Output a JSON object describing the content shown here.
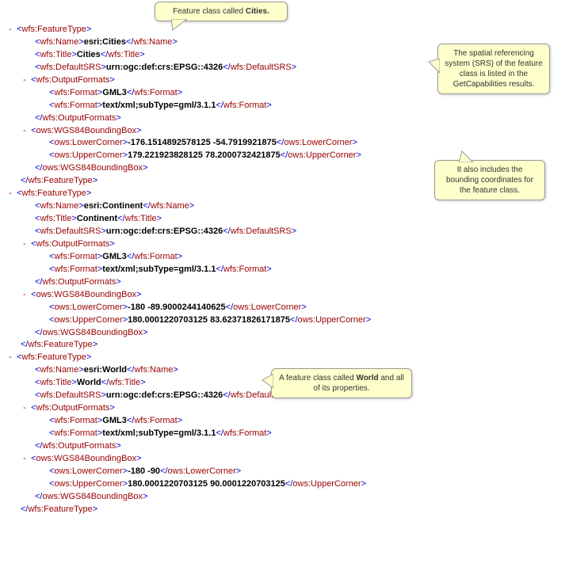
{
  "callout1": {
    "pre": "Feature class called ",
    "bold": "Cities.",
    "post": ""
  },
  "callout2": "The spatial referencing system (SRS) of the feature class is listed in the GetCapabilities results.",
  "callout3": "It also includes the bounding coordinates for the feature class.",
  "callout4": {
    "pre": "A feature class called ",
    "bold": "World",
    "post": " and all of its properties."
  },
  "ft": [
    {
      "name": "esri:Cities",
      "title": "Cities",
      "srs": "urn:ogc:def:crs:EPSG::4326",
      "fmt1": "GML3",
      "fmt2": "text/xml;subType=gml/3.1.1",
      "lower": "-176.1514892578125 -54.7919921875",
      "upper": "179.221923828125 78.2000732421875"
    },
    {
      "name": "esri:Continent",
      "title": "Continent",
      "srs": "urn:ogc:def:crs:EPSG::4326",
      "fmt1": "GML3",
      "fmt2": "text/xml;subType=gml/3.1.1",
      "lower": "-180 -89.9000244140625",
      "upper": "180.0001220703125 83.62371826171875"
    },
    {
      "name": "esri:World",
      "title": "World",
      "srs": "urn:ogc:def:crs:EPSG::4326",
      "fmt1": "GML3",
      "fmt2": "text/xml;subType=gml/3.1.1",
      "lower": "-180 -90",
      "upper": "180.0001220703125 90.0001220703125"
    }
  ],
  "tags": {
    "featureTypeOpen": "wfs:FeatureType",
    "featureTypeClose": "wfs:FeatureType",
    "name": "wfs:Name",
    "title": "wfs:Title",
    "srs": "wfs:DefaultSRS",
    "outputFormatsOpen": "wfs:OutputFormats",
    "outputFormatsClose": "wfs:OutputFormats",
    "format": "wfs:Format",
    "bboxOpen": "ows:WGS84BoundingBox",
    "bboxClose": "ows:WGS84BoundingBox",
    "lower": "ows:LowerCorner",
    "upper": "ows:UpperCorner"
  }
}
